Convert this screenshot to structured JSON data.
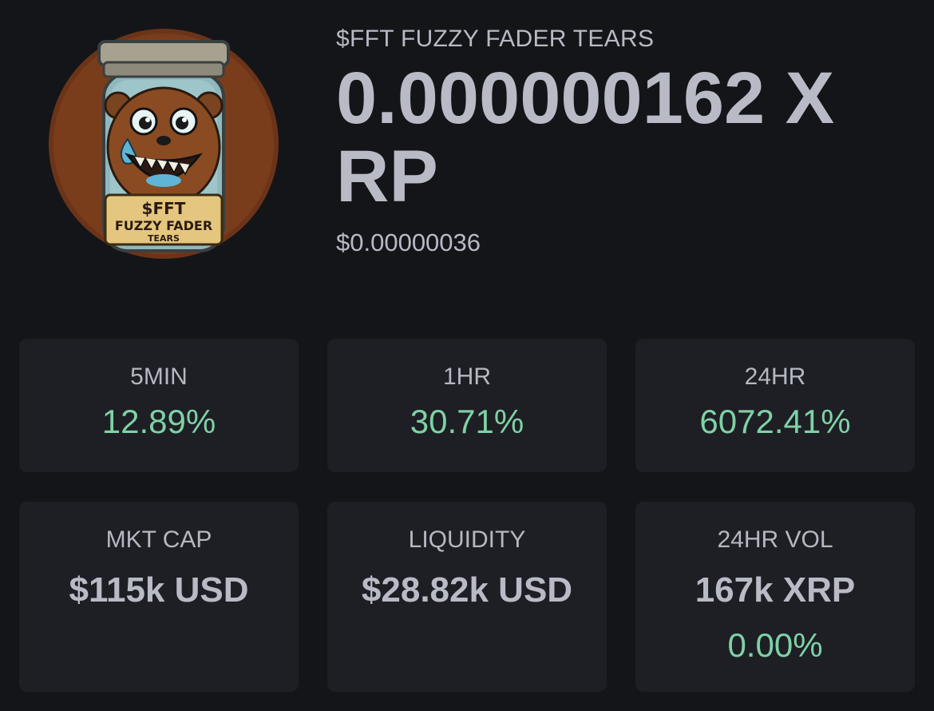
{
  "token": {
    "logo_text_line1": "$FFT",
    "logo_text_line2": "FUZZY FADER",
    "logo_text_line3": "TEARS",
    "title": "$FFT FUZZY FADER TEARS",
    "price_xrp": "0.000000162 XRP",
    "price_usd": "$0.00000036"
  },
  "changes": [
    {
      "label": "5MIN",
      "value": "12.89%"
    },
    {
      "label": "1HR",
      "value": "30.71%"
    },
    {
      "label": "24HR",
      "value": "6072.41%"
    }
  ],
  "stats": {
    "mkt_cap": {
      "label": "MKT CAP",
      "value": "$115k USD"
    },
    "liquidity": {
      "label": "LIQUIDITY",
      "value": "$28.82k USD"
    },
    "vol": {
      "label": "24HR VOL",
      "value": "167k XRP",
      "change": "0.00%"
    }
  },
  "colors": {
    "background": "#141519",
    "card": "#1d1f24",
    "positive": "#7fd1a6",
    "text": "#b8bbc6"
  }
}
